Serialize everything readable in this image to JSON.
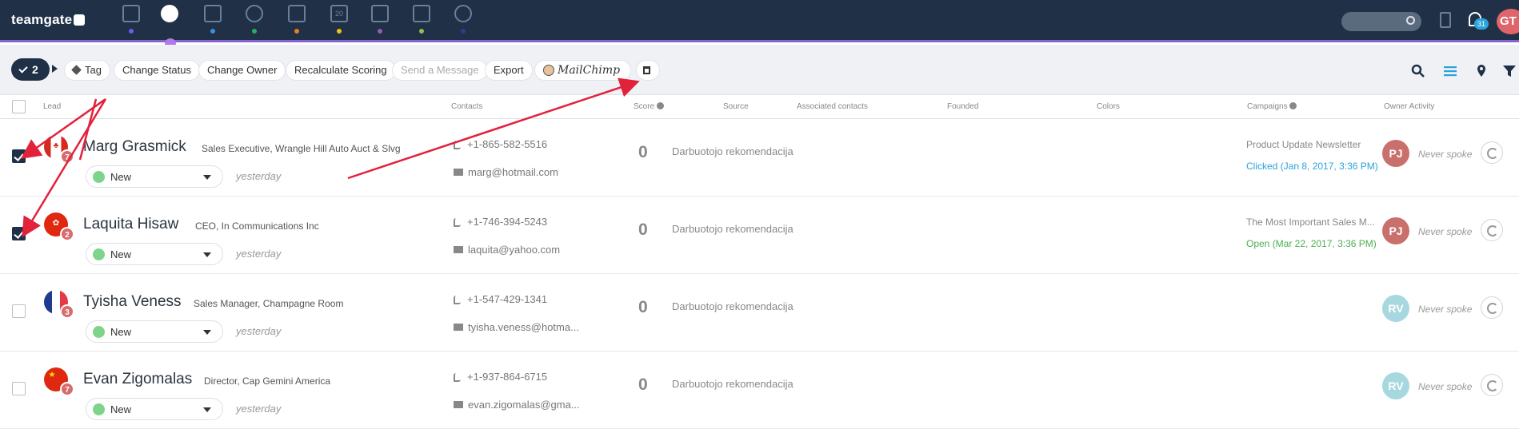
{
  "app": {
    "logo_text": "teamgate"
  },
  "topbar": {
    "nav": [
      {
        "name": "dashboard-icon",
        "dot": "#6c5ce7"
      },
      {
        "name": "leads-icon",
        "dot": "#b07ae8",
        "active": true
      },
      {
        "name": "companies-icon",
        "dot": "#3d8fd6"
      },
      {
        "name": "contacts-icon",
        "dot": "#27ae60"
      },
      {
        "name": "deals-icon",
        "dot": "#e67e22"
      },
      {
        "name": "calendar-icon",
        "dot": "#f1c40f",
        "label": "20"
      },
      {
        "name": "inbox-icon",
        "dot": "#9b59b6"
      },
      {
        "name": "documents-icon",
        "dot": "#8bc34a"
      },
      {
        "name": "reports-icon",
        "dot": "#2c3e8f"
      }
    ],
    "notifications": "31",
    "avatar": "GT"
  },
  "toolbar": {
    "selected_count": "2",
    "tag": "Tag",
    "change_status": "Change Status",
    "change_owner": "Change Owner",
    "recalculate": "Recalculate Scoring",
    "send_message": "Send a Message",
    "export": "Export",
    "mailchimp": "MailChimp"
  },
  "columns": {
    "lead": "Lead",
    "contacts": "Contacts",
    "score": "Score",
    "source": "Source",
    "associated": "Associated contacts",
    "founded": "Founded",
    "colors": "Colors",
    "campaigns": "Campaigns",
    "owner_activity": "Owner Activity"
  },
  "rows": [
    {
      "name": "Marg Grasmick",
      "title": "Sales Executive, Wrangle Hill Auto Auct & Slvg",
      "flag": "ca",
      "badge": "7",
      "status": "New",
      "when": "yesterday",
      "phone": "+1-865-582-5516",
      "email": "marg@hotmail.com",
      "score": "0",
      "source": "Darbuotojo rekomendacija",
      "campaign": "Product Update Newsletter",
      "campaign_status": "Clicked (Jan 8, 2017, 3:36 PM)",
      "campaign_color": "#2ba3db",
      "owner": "PJ",
      "owner_color": "#c9706c",
      "activity": "Never spoke",
      "checked": true
    },
    {
      "name": "Laquita Hisaw",
      "title": "CEO, In Communications Inc",
      "flag": "hk",
      "badge": "2",
      "status": "New",
      "when": "yesterday",
      "phone": "+1-746-394-5243",
      "email": "laquita@yahoo.com",
      "score": "0",
      "source": "Darbuotojo rekomendacija",
      "campaign": "The Most Important Sales M...",
      "campaign_status": "Open (Mar 22, 2017, 3:36 PM)",
      "campaign_color": "#4caf50",
      "owner": "PJ",
      "owner_color": "#c9706c",
      "activity": "Never spoke",
      "checked": true
    },
    {
      "name": "Tyisha Veness",
      "title": "Sales Manager, Champagne Room",
      "flag": "fr",
      "badge": "3",
      "status": "New",
      "when": "yesterday",
      "phone": "+1-547-429-1341",
      "email": "tyisha.veness@hotma...",
      "score": "0",
      "source": "Darbuotojo rekomendacija",
      "campaign": "",
      "campaign_status": "",
      "campaign_color": "#888888",
      "owner": "RV",
      "owner_color": "#a8d8df",
      "activity": "Never spoke",
      "checked": false
    },
    {
      "name": "Evan Zigomalas",
      "title": "Director, Cap Gemini America",
      "flag": "cn",
      "badge": "7",
      "status": "New",
      "when": "yesterday",
      "phone": "+1-937-864-6715",
      "email": "evan.zigomalas@gma...",
      "score": "0",
      "source": "Darbuotojo rekomendacija",
      "campaign": "",
      "campaign_status": "",
      "campaign_color": "#888888",
      "owner": "RV",
      "owner_color": "#a8d8df",
      "activity": "Never spoke",
      "checked": false
    }
  ],
  "colors": {
    "accent": "#1f3047",
    "annotation": "#e2213b"
  }
}
